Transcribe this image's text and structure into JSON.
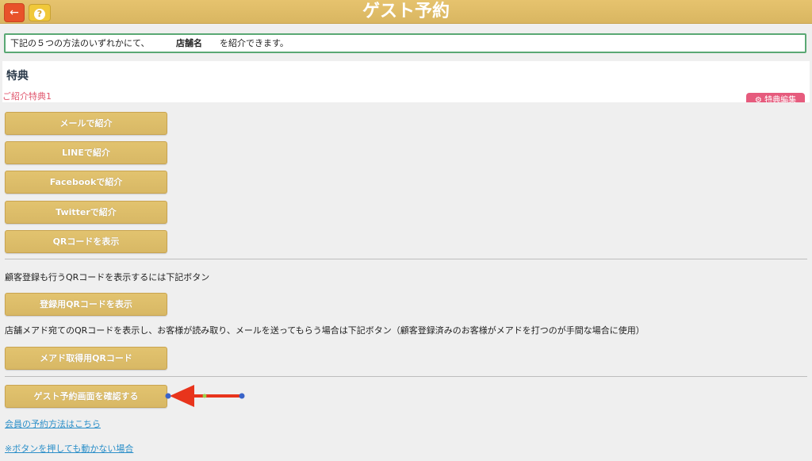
{
  "header": {
    "back_icon": "arrow-left-icon",
    "help_icon": "question-icon",
    "help_glyph": "?",
    "title": "ゲスト予約"
  },
  "notice": {
    "prefix": "下記の５つの方法のいずれかにて、",
    "store_name": "店舗名",
    "suffix": "を紹介できます。"
  },
  "benefit": {
    "title": "特典",
    "item": "ご紹介特典1",
    "edit_button": "特典編集"
  },
  "share_buttons": [
    "メールで紹介",
    "LINEで紹介",
    "Facebookで紹介",
    "Twitterで紹介",
    "QRコードを表示"
  ],
  "register_qr": {
    "description": "顧客登録も行うQRコードを表示するには下記ボタン",
    "button": "登録用QRコードを表示"
  },
  "email_qr": {
    "description": "店舗メアド宛てのQRコードを表示し、お客様が読み取り、メールを送ってもらう場合は下記ボタン（顧客登録済みのお客様がメアドを打つのが手間な場合に使用）",
    "button": "メアド取得用QRコード"
  },
  "confirm_button": "ゲスト予約画面を確認する",
  "links": {
    "member_reservation": "会員の予約方法はこちら",
    "not_working": "※ボタンを押しても動かない場合"
  },
  "colors": {
    "header_gold": "#d9b661",
    "button_gold": "#d8b865",
    "back_red": "#e8522a",
    "accent_pink": "#e65b7d",
    "notice_border": "#5aa874",
    "link_blue": "#2b8fc9",
    "annotation_arrow": "#e8341c"
  }
}
